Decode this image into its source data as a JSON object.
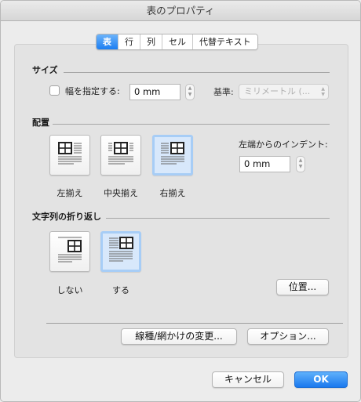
{
  "window": {
    "title": "表のプロパティ"
  },
  "tabs": [
    {
      "label": "表",
      "active": true
    },
    {
      "label": "行",
      "active": false
    },
    {
      "label": "列",
      "active": false
    },
    {
      "label": "セル",
      "active": false
    },
    {
      "label": "代替テキスト",
      "active": false
    }
  ],
  "size": {
    "section_label": "サイズ",
    "specify_width_label": "幅を指定する:",
    "specify_width_checked": false,
    "width_value": "0 mm",
    "basis_label": "基準:",
    "basis_value": "ミリメートル (..."
  },
  "alignment": {
    "section_label": "配置",
    "options": [
      {
        "label": "左揃え",
        "selected": false
      },
      {
        "label": "中央揃え",
        "selected": false
      },
      {
        "label": "右揃え",
        "selected": true
      }
    ],
    "indent_label": "左端からのインデント:",
    "indent_value": "0 mm"
  },
  "wrapping": {
    "section_label": "文字列の折り返し",
    "options": [
      {
        "label": "しない",
        "selected": false
      },
      {
        "label": "する",
        "selected": true
      }
    ],
    "position_button": "位置..."
  },
  "buttons": {
    "borders": "線種/網かけの変更...",
    "options": "オプション...",
    "cancel": "キャンセル",
    "ok": "OK"
  },
  "colors": {
    "accent": "#1c7ef2",
    "selected_tile_bg": "#d8e8fb",
    "selected_tile_border": "#a7cdf6"
  }
}
